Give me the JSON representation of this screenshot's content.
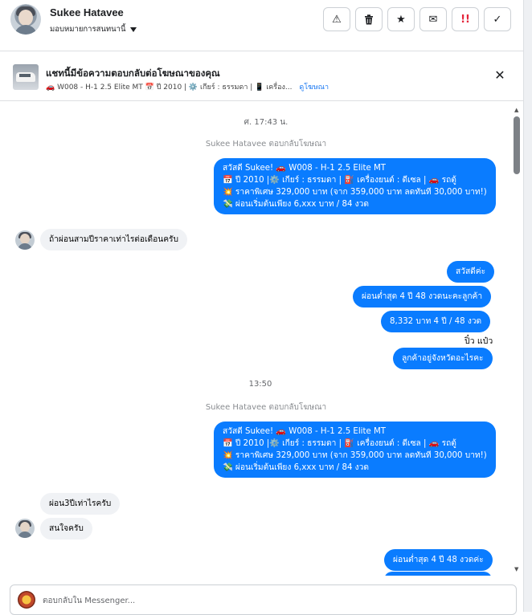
{
  "header": {
    "contact_name": "Sukee Hatavee",
    "assign_label": "มอบหมายการสนทนานี้",
    "toolbar": [
      {
        "name": "report-spam-button",
        "icon": "warning-triangle-icon",
        "glyph": "⚠"
      },
      {
        "name": "delete-button",
        "icon": "trash-icon",
        "glyph": "🗑"
      },
      {
        "name": "star-button",
        "icon": "star-icon",
        "glyph": "★"
      },
      {
        "name": "mark-unread-button",
        "icon": "envelope-icon",
        "glyph": "✉"
      },
      {
        "name": "follow-up-button",
        "icon": "double-exclamation-icon",
        "glyph": "!!"
      },
      {
        "name": "done-button",
        "icon": "checkmark-icon",
        "glyph": "✓"
      }
    ]
  },
  "ad": {
    "title": "แชทนี้มีข้อความตอบกลับต่อโฆษณาของคุณ",
    "details": "🚗 W008 - H-1 2.5 Elite MT 📅 ปี 2010 | ⚙️ เกียร์ : ธรรมดา | 📱 เครื่อง...",
    "link": "ดูโฆษณา"
  },
  "chat": {
    "stamp1": "ศ. 17:43 น.",
    "reply1": "Sukee Hatavee ตอบกลับโฆษณา",
    "ad_msg_lines": [
      "สวัสดี Sukee! 🚗 W008 - H-1 2.5 Elite MT",
      "📅 ปี 2010 |⚙️ เกียร์ : ธรรมดา | ⛽ เครื่องยนต์ : ดีเซล | 🚗 รถตู้",
      "💥 ราคาพิเศษ 329,000 บาท (จาก 359,000 บาท ลดทันที 30,000 บาท!)",
      "💸 ผ่อนเริ่มต้นเพียง 6,xxx บาท / 84 งวด"
    ],
    "in1": "ถ้าผ่อนสามปีราคาเท่าไรต่อเดือนครับ",
    "out1": "สวัสดีค่ะ",
    "out2": "ผ่อนต่ำสุด 4 ปี  48 งวดนะคะลูกค้า",
    "out3": "8,332 บาท   4 ปี / 48 งวด",
    "sender_label": "ปิ๋ว แป๋ว",
    "out4": "ลูกค้าอยู่จังหวัดอะไรคะ",
    "stamp2": "13:50",
    "reply2": "Sukee Hatavee ตอบกลับโฆษณา",
    "in2": "ผ่อน3ปีเท่าไรครับ",
    "in3": "สนใจครับ",
    "out5": "ผ่อนต่ำสุด 4 ปี  48 งวดค่ะ"
  },
  "composer": {
    "placeholder": "ตอบกลับใน Messenger..."
  }
}
